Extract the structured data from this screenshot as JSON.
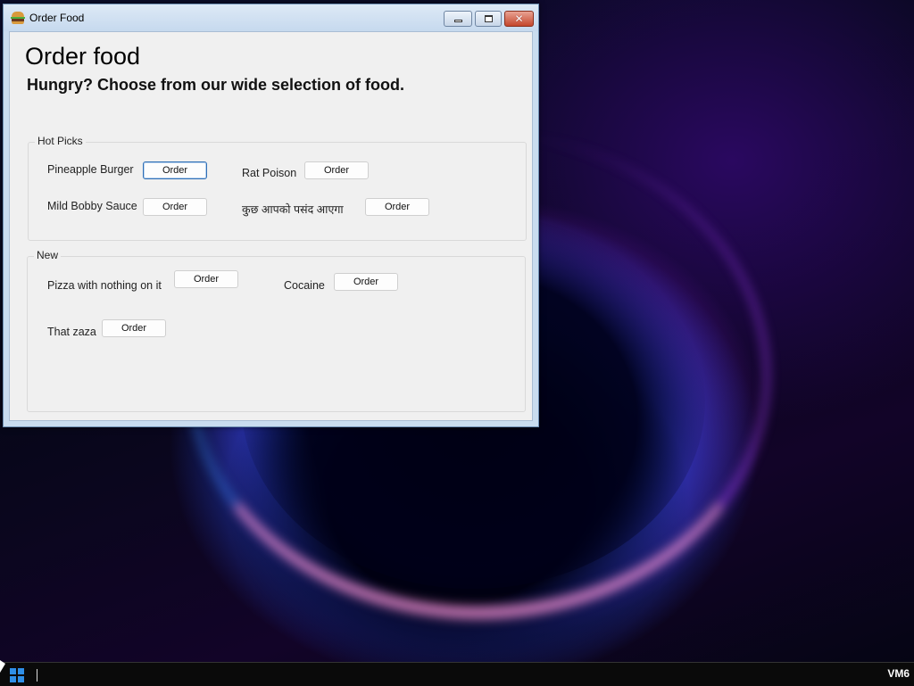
{
  "window": {
    "title": "Order Food",
    "icon": "burger-icon",
    "controls": {
      "minimize": "minimize-icon",
      "maximize": "maximize-icon",
      "close": "✕"
    }
  },
  "header": {
    "title": "Order food",
    "subtitle": "Hungry? Choose from our wide selection of food."
  },
  "groups": {
    "hot_picks": {
      "label": "Hot Picks",
      "items": [
        {
          "name": "Pineapple Burger",
          "button": "Order"
        },
        {
          "name": "Rat Poison",
          "button": "Order"
        },
        {
          "name": "Mild Bobby Sauce",
          "button": "Order"
        },
        {
          "name": "कुछ आपको पसंद आएगा",
          "button": "Order"
        }
      ]
    },
    "new": {
      "label": "New",
      "items": [
        {
          "name": "Pizza with nothing on it",
          "button": "Order"
        },
        {
          "name": "Cocaine",
          "button": "Order"
        },
        {
          "name": "That zaza",
          "button": "Order"
        }
      ]
    }
  },
  "taskbar": {
    "start_icon": "windows-start-icon",
    "vm_label": "VM6"
  },
  "colors": {
    "titlebar": "#c6d9ee",
    "client_bg": "#f0f0f0",
    "close_button": "#c4462c",
    "focused_border": "#2f6fb5"
  }
}
